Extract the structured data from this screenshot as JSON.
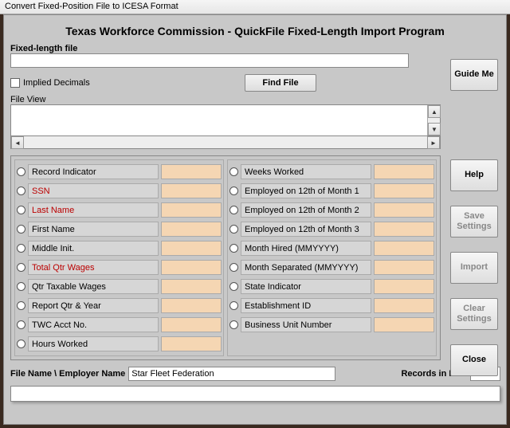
{
  "title_bar": "Convert Fixed-Position File to ICESA Format",
  "header": "Texas Workforce Commission - QuickFile Fixed-Length Import Program",
  "file_label": "Fixed-length file",
  "file_value": "",
  "implied_decimals_label": "Implied Decimals",
  "find_file_label": "Find File",
  "file_view_label": "File View",
  "sidebar": {
    "guide_me": "Guide\nMe",
    "help": "Help",
    "save_settings": "Save\nSettings",
    "import": "Import",
    "clear_settings": "Clear\nSettings",
    "close": "Close"
  },
  "fields_left": [
    {
      "label": "Record Indicator",
      "red": false
    },
    {
      "label": "SSN",
      "red": true
    },
    {
      "label": "Last Name",
      "red": true
    },
    {
      "label": "First Name",
      "red": false
    },
    {
      "label": "Middle Init.",
      "red": false
    },
    {
      "label": "Total Qtr Wages",
      "red": true
    },
    {
      "label": "Qtr Taxable Wages",
      "red": false
    },
    {
      "label": "Report Qtr & Year",
      "red": false
    },
    {
      "label": "TWC Acct No.",
      "red": false
    },
    {
      "label": "Hours Worked",
      "red": false
    }
  ],
  "fields_right": [
    {
      "label": "Weeks Worked",
      "red": false
    },
    {
      "label": "Employed on 12th of Month 1",
      "red": false
    },
    {
      "label": "Employed on 12th of Month 2",
      "red": false
    },
    {
      "label": "Employed on 12th of Month 3",
      "red": false
    },
    {
      "label": "Month Hired (MMYYYY)",
      "red": false
    },
    {
      "label": "Month Separated (MMYYYY)",
      "red": false
    },
    {
      "label": "State Indicator",
      "red": false
    },
    {
      "label": "Establishment ID",
      "red": false
    },
    {
      "label": "Business Unit Number",
      "red": false
    }
  ],
  "filename_label": "File Name \\ Employer Name",
  "filename_value": "Star Fleet Federation",
  "records_label": "Records in File:",
  "records_value": ""
}
